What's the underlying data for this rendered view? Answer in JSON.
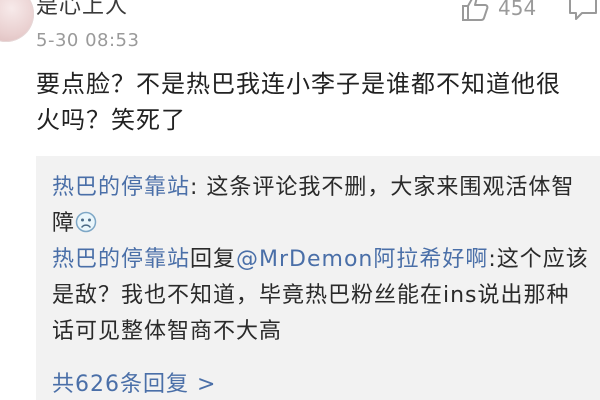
{
  "comment": {
    "username": "是心上人",
    "timestamp": "5-30 08:53",
    "text": "要点脸？不是热巴我连小李子是谁都不知道他很火吗？笑死了",
    "like_count": "454",
    "icons": [
      "thumbs-up-icon",
      "comment-icon"
    ]
  },
  "replies": [
    {
      "name": "热巴的停靠站",
      "sep": ": ",
      "text": "这条评论我不删，大家来围观活体智障",
      "emoji": "frowning-face-emoji"
    },
    {
      "name": "热巴的停靠站",
      "reply_word": "回复",
      "mention": "@MrDemon阿拉希好啊",
      "sep": ":",
      "text": "这个应该是敌？我也不知道，毕竟热巴粉丝能在ins说出那种话可见整体智商不大高"
    }
  ],
  "replies_footer": {
    "label": "共626条回复 >"
  },
  "colors": {
    "link": "#4a6fa8",
    "text": "#222222",
    "meta": "#9a9a9a",
    "reply_bg": "#f2f2f2"
  }
}
